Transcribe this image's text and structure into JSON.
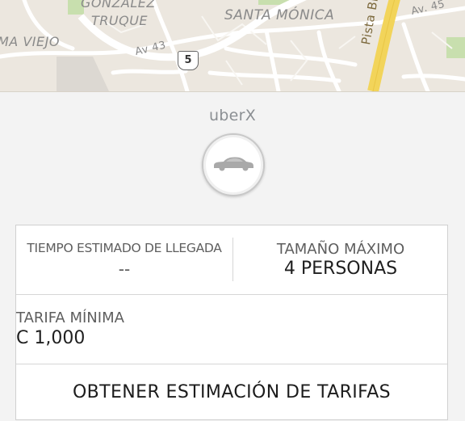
{
  "map": {
    "labels": {
      "gonzalez": "GONZÁLEZ",
      "truque": "TRUQUE",
      "santa_monica": "SANTA MÓNICA",
      "viejo": "MA VIEJO",
      "av43": "Av 43",
      "av45": "Av. 45",
      "braulio": "Pista Braulio Car"
    },
    "route_shield": "5"
  },
  "product": {
    "name": "uberX",
    "icon": "car-icon"
  },
  "info": {
    "eta": {
      "label": "TIEMPO ESTIMADO DE LLEGADA",
      "value": "--"
    },
    "capacity": {
      "label": "TAMAÑO MÁXIMO",
      "value": "4 PERSONAS"
    },
    "minimum_fare": {
      "label": "TARIFA MÍNIMA",
      "value": "C 1,000"
    },
    "estimate_button": "OBTENER ESTIMACIÓN DE TARIFAS"
  },
  "colors": {
    "background": "#f3f3f3",
    "card": "#ffffff",
    "map_base": "#ece7df",
    "map_road": "#ffffff",
    "map_highway": "#f7d95c",
    "map_park": "#c8dfae"
  }
}
